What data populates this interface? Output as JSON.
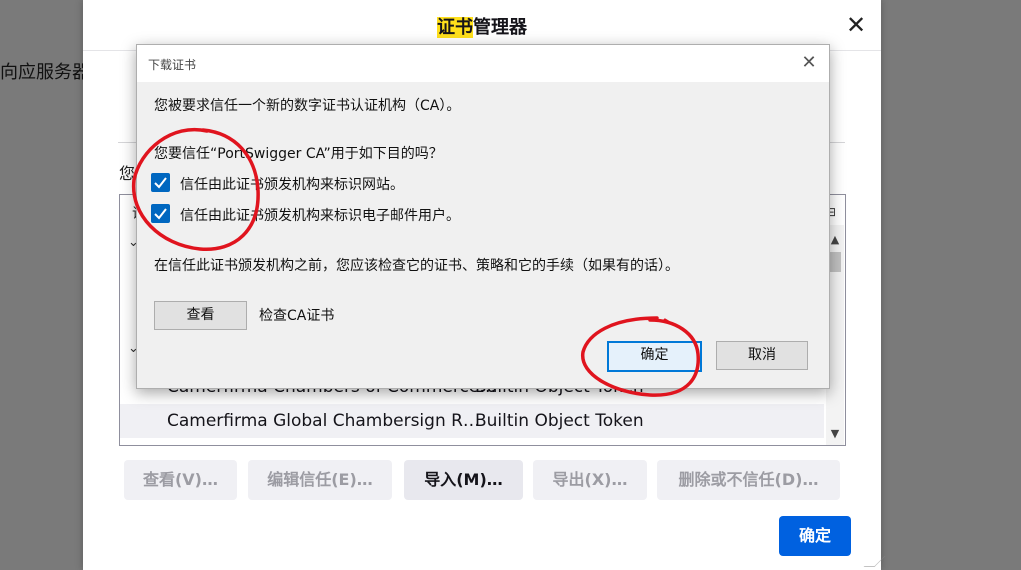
{
  "background": {
    "left_text": "向应服务器上"
  },
  "manager": {
    "title_highlight": "证书",
    "title_rest": "管理器",
    "close_glyph": "✕",
    "partial_label": "您",
    "tree": {
      "column_partial": "证",
      "column_picker_glyph": "⊟",
      "chevron_glyph": "⌄",
      "rows": [
        {
          "name": "Camerfirma Chambers of Commerce…",
          "token": "Builtin Object Token"
        },
        {
          "name": "Camerfirma Global Chambersign R…",
          "token": "Builtin Object Token"
        }
      ]
    },
    "buttons": {
      "view": "查看(V)…",
      "edit_trust": "编辑信任(E)…",
      "import": "导入(M)…",
      "export": "导出(X)…",
      "delete": "删除或不信任(D)…"
    },
    "ok": "确定"
  },
  "dialog": {
    "title": "下载证书",
    "close_glyph": "✕",
    "intro": "您被要求信任一个新的数字证书认证机构（CA）。",
    "question": "您要信任“PortSwigger CA”用于如下目的吗？",
    "options": [
      {
        "label": "信任由此证书颁发机构来标识网站。",
        "checked": true
      },
      {
        "label": "信任由此证书颁发机构来标识电子邮件用户。",
        "checked": true
      }
    ],
    "advice": "在信任此证书颁发机构之前，您应该检查它的证书、策略和它的手续（如果有的话）。",
    "view_button": "查看",
    "view_caption": "检查CA证书",
    "ok_button": "确定",
    "cancel_button": "取消"
  },
  "colors": {
    "accent": "#0061e0",
    "checkbox": "#0067c0",
    "annotation": "#e0141e",
    "highlight": "#ffe01b"
  }
}
